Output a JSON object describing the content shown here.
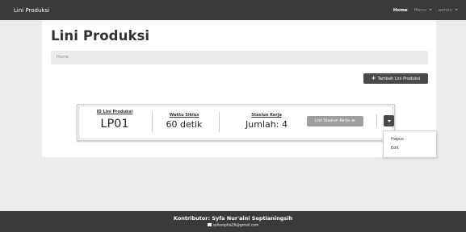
{
  "navbar": {
    "brand": "Lini Produksi",
    "items": [
      {
        "label": "Home",
        "active": true
      },
      {
        "label": "Menu",
        "dropdown": true
      },
      {
        "label": "admin",
        "dropdown": true
      }
    ]
  },
  "page": {
    "title": "Lini Produksi",
    "breadcrumb": "Home",
    "add_button_label": "Tambah Lini Produksi",
    "add_button_icon": "plus-icon"
  },
  "card": {
    "id_label": "ID Lini Produksi",
    "id_value": "LP01",
    "cycle_label": "Waktu Siklus",
    "cycle_value": "60 detik",
    "stations_label": "Stasiun Kerja",
    "stations_value": "Jumlah: 4",
    "list_button_label": "List Stasiun Kerja ≫"
  },
  "dropdown_menu": {
    "items": [
      "Hapus",
      "Edit"
    ]
  },
  "footer": {
    "contributor": "Kontributor: Syfa Nur'aini Septianingsih",
    "email": "syfaseptia26@gmail.com",
    "email_icon": "envelope-icon"
  },
  "colors": {
    "navbar_bg": "#3a3a3a",
    "page_bg": "#ececec",
    "button_dark": "#4a4a4a",
    "button_muted": "#9e9e9e"
  }
}
